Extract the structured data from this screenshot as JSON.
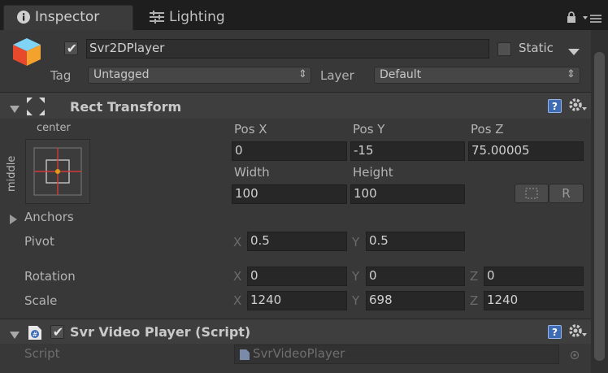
{
  "tabs": [
    {
      "label": "Inspector",
      "icon": "info-icon",
      "active": true
    },
    {
      "label": "Lighting",
      "icon": "lighting-sliders-icon",
      "active": false
    }
  ],
  "object": {
    "name": "Svr2DPlayer",
    "active": true,
    "static_label": "Static",
    "static_checked": false,
    "tag_label": "Tag",
    "tag_value": "Untagged",
    "layer_label": "Layer",
    "layer_value": "Default"
  },
  "rect_transform": {
    "title": "Rect Transform",
    "anchor_h_label": "center",
    "anchor_v_label": "middle",
    "pos_x_label": "Pos X",
    "pos_x": "0",
    "pos_y_label": "Pos Y",
    "pos_y": "-15",
    "pos_z_label": "Pos Z",
    "pos_z": "75.00005",
    "width_label": "Width",
    "width": "100",
    "height_label": "Height",
    "height": "100",
    "r_button": "R",
    "anchors_label": "Anchors",
    "pivot_label": "Pivot",
    "pivot_x": "0.5",
    "pivot_y": "0.5",
    "rotation_label": "Rotation",
    "rot_x": "0",
    "rot_y": "0",
    "rot_z": "0",
    "scale_label": "Scale",
    "scale_x": "1240",
    "scale_y": "698",
    "scale_z": "1240",
    "axis_x": "X",
    "axis_y": "Y",
    "axis_z": "Z"
  },
  "video_player": {
    "title": "Svr Video Player (Script)",
    "enabled": true,
    "script_label": "Script",
    "script_value": "SvrVideoPlayer"
  },
  "colors": {
    "accent_blue": "#3d6cb5",
    "anchor_red": "#d23a3a",
    "pivot_orange": "#e09a1a"
  }
}
